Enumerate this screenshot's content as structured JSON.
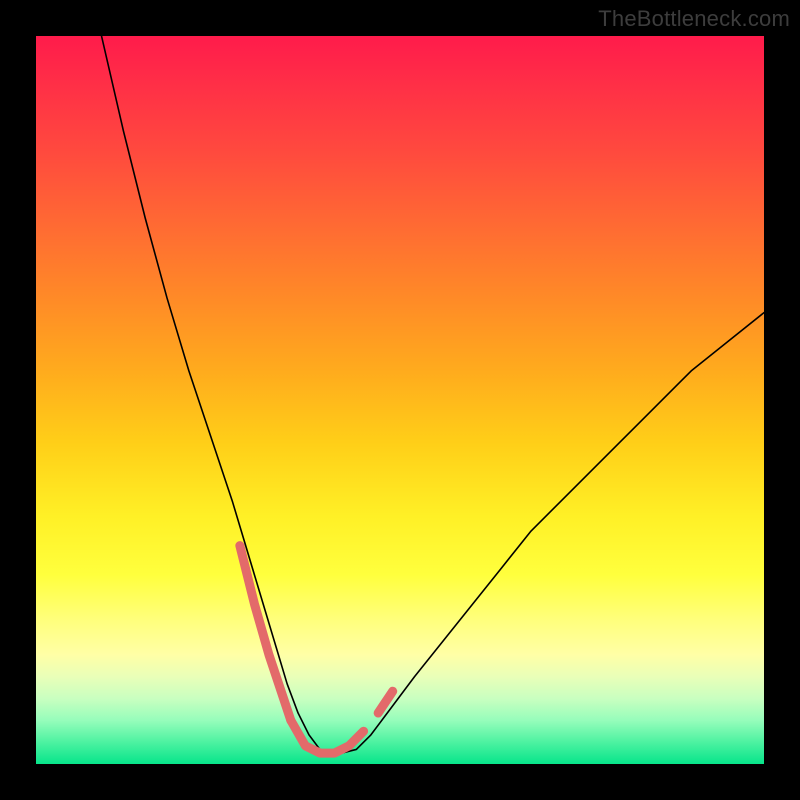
{
  "watermark": "TheBottleneck.com",
  "chart_data": {
    "type": "line",
    "title": "",
    "xlabel": "",
    "ylabel": "",
    "xlim": [
      0,
      100
    ],
    "ylim": [
      0,
      100
    ],
    "grid": false,
    "series": [
      {
        "name": "curve",
        "color": "#000000",
        "stroke_width": 1.6,
        "x": [
          9,
          12,
          15,
          18,
          21,
          24,
          27,
          30,
          31.5,
          33,
          34.5,
          36,
          37.5,
          39,
          40.5,
          42,
          44,
          46,
          49,
          52,
          56,
          60,
          64,
          68,
          72,
          76,
          80,
          85,
          90,
          95,
          100
        ],
        "y": [
          100,
          87,
          75,
          64,
          54,
          45,
          36,
          26,
          21,
          16,
          11,
          7,
          4,
          2,
          1.5,
          1.5,
          2,
          4,
          8,
          12,
          17,
          22,
          27,
          32,
          36,
          40,
          44,
          49,
          54,
          58,
          62
        ]
      },
      {
        "name": "highlight-left",
        "color": "#e36a6a",
        "stroke_width": 9,
        "x": [
          28,
          30,
          32,
          34,
          35
        ],
        "y": [
          30,
          22,
          15,
          9,
          6
        ]
      },
      {
        "name": "highlight-bottom",
        "color": "#e36a6a",
        "stroke_width": 9,
        "x": [
          35,
          37,
          39,
          41,
          43,
          45
        ],
        "y": [
          6,
          2.5,
          1.5,
          1.5,
          2.5,
          4.5
        ]
      },
      {
        "name": "highlight-right",
        "color": "#e36a6a",
        "stroke_width": 9,
        "x": [
          47,
          49
        ],
        "y": [
          7,
          10
        ]
      }
    ],
    "background_gradient": {
      "type": "vertical",
      "stops": [
        {
          "pos": 0.0,
          "color": "#ff1b4b"
        },
        {
          "pos": 0.3,
          "color": "#ff7a2c"
        },
        {
          "pos": 0.6,
          "color": "#ffe61e"
        },
        {
          "pos": 0.82,
          "color": "#ffff80"
        },
        {
          "pos": 1.0,
          "color": "#07e58b"
        }
      ]
    }
  }
}
